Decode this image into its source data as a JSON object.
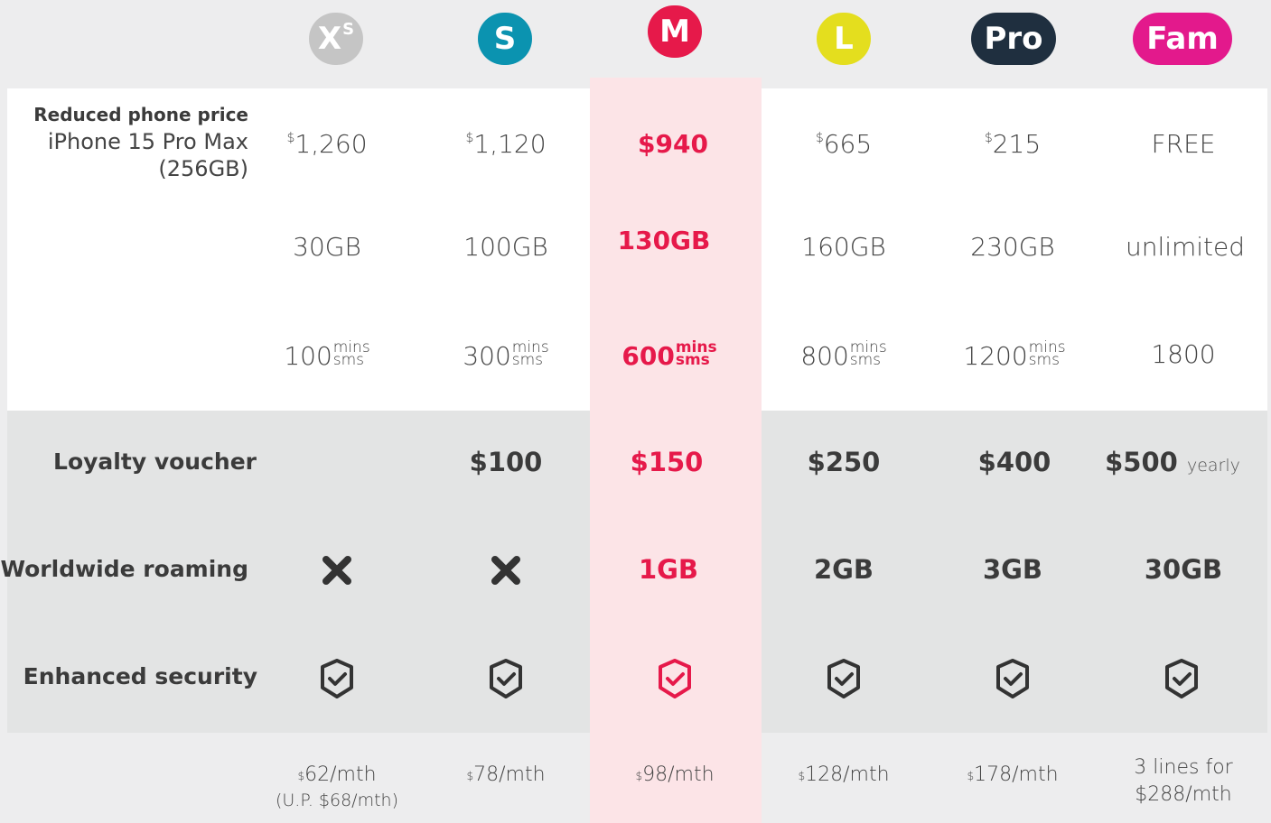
{
  "plans": [
    {
      "badge": "X",
      "badge_sup": "S",
      "color": "#c5c5c5"
    },
    {
      "badge": "S",
      "color": "#0b93b0"
    },
    {
      "badge": "M",
      "color": "#e6194a"
    },
    {
      "badge": "L",
      "color": "#e4de1e"
    },
    {
      "badge": "Pro",
      "color": "#1f2f3f"
    },
    {
      "badge": "Fam",
      "color": "#e3198c"
    }
  ],
  "labels": {
    "reduced_price_title": "Reduced phone price",
    "reduced_price_model": "iPhone 15 Pro Max",
    "reduced_price_storage": "(256GB)",
    "loyalty": "Loyalty voucher",
    "roaming": "Worldwide roaming",
    "security": "Enhanced security"
  },
  "phone_price": {
    "currency": "$",
    "values": [
      "1,260",
      "1,120",
      "$940",
      "665",
      "215",
      "FREE"
    ]
  },
  "data_allowance": [
    "30GB",
    "100GB",
    "130GB",
    "160GB",
    "230GB",
    "unlimited"
  ],
  "talktime": {
    "values": [
      "100",
      "300",
      "600",
      "800",
      "1200",
      "1800"
    ],
    "unit_top": "mins",
    "unit_bottom": "sms"
  },
  "loyalty": [
    "",
    "$100",
    "$150",
    "$250",
    "$400",
    "$500"
  ],
  "loyalty_suffix": "yearly",
  "roaming": [
    "x-icon",
    "x-icon",
    "1GB",
    "2GB",
    "3GB",
    "30GB"
  ],
  "security_icon": "shield-check-icon",
  "monthly": {
    "currency": "$",
    "values": [
      "62/mth",
      "78/mth",
      "98/mth",
      "128/mth",
      "178/mth"
    ],
    "xs_usual": "(U.P. $68/mth)",
    "fam_line1": "3 lines for",
    "fam_line2": "$288/mth"
  },
  "colors": {
    "accent_red": "#e6194a",
    "highlight_bg": "#fce4e7",
    "text_dark": "#3b3b3b"
  }
}
